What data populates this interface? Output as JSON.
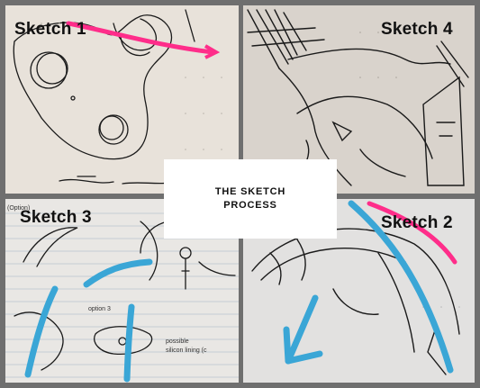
{
  "panels": {
    "top_left": {
      "label": "Sketch 1"
    },
    "top_right": {
      "label": "Sketch 4"
    },
    "bottom_left": {
      "label": "Sketch 3"
    },
    "bottom_right": {
      "label": "Sketch 2"
    }
  },
  "center_card": {
    "line1": "THE SKETCH",
    "line2": "PROCESS"
  },
  "colors": {
    "frame": "#6f6f6f",
    "pink_marker": "#ff2d8a",
    "blue_marker": "#3aa6d6",
    "pencil": "#1a1a1a"
  }
}
